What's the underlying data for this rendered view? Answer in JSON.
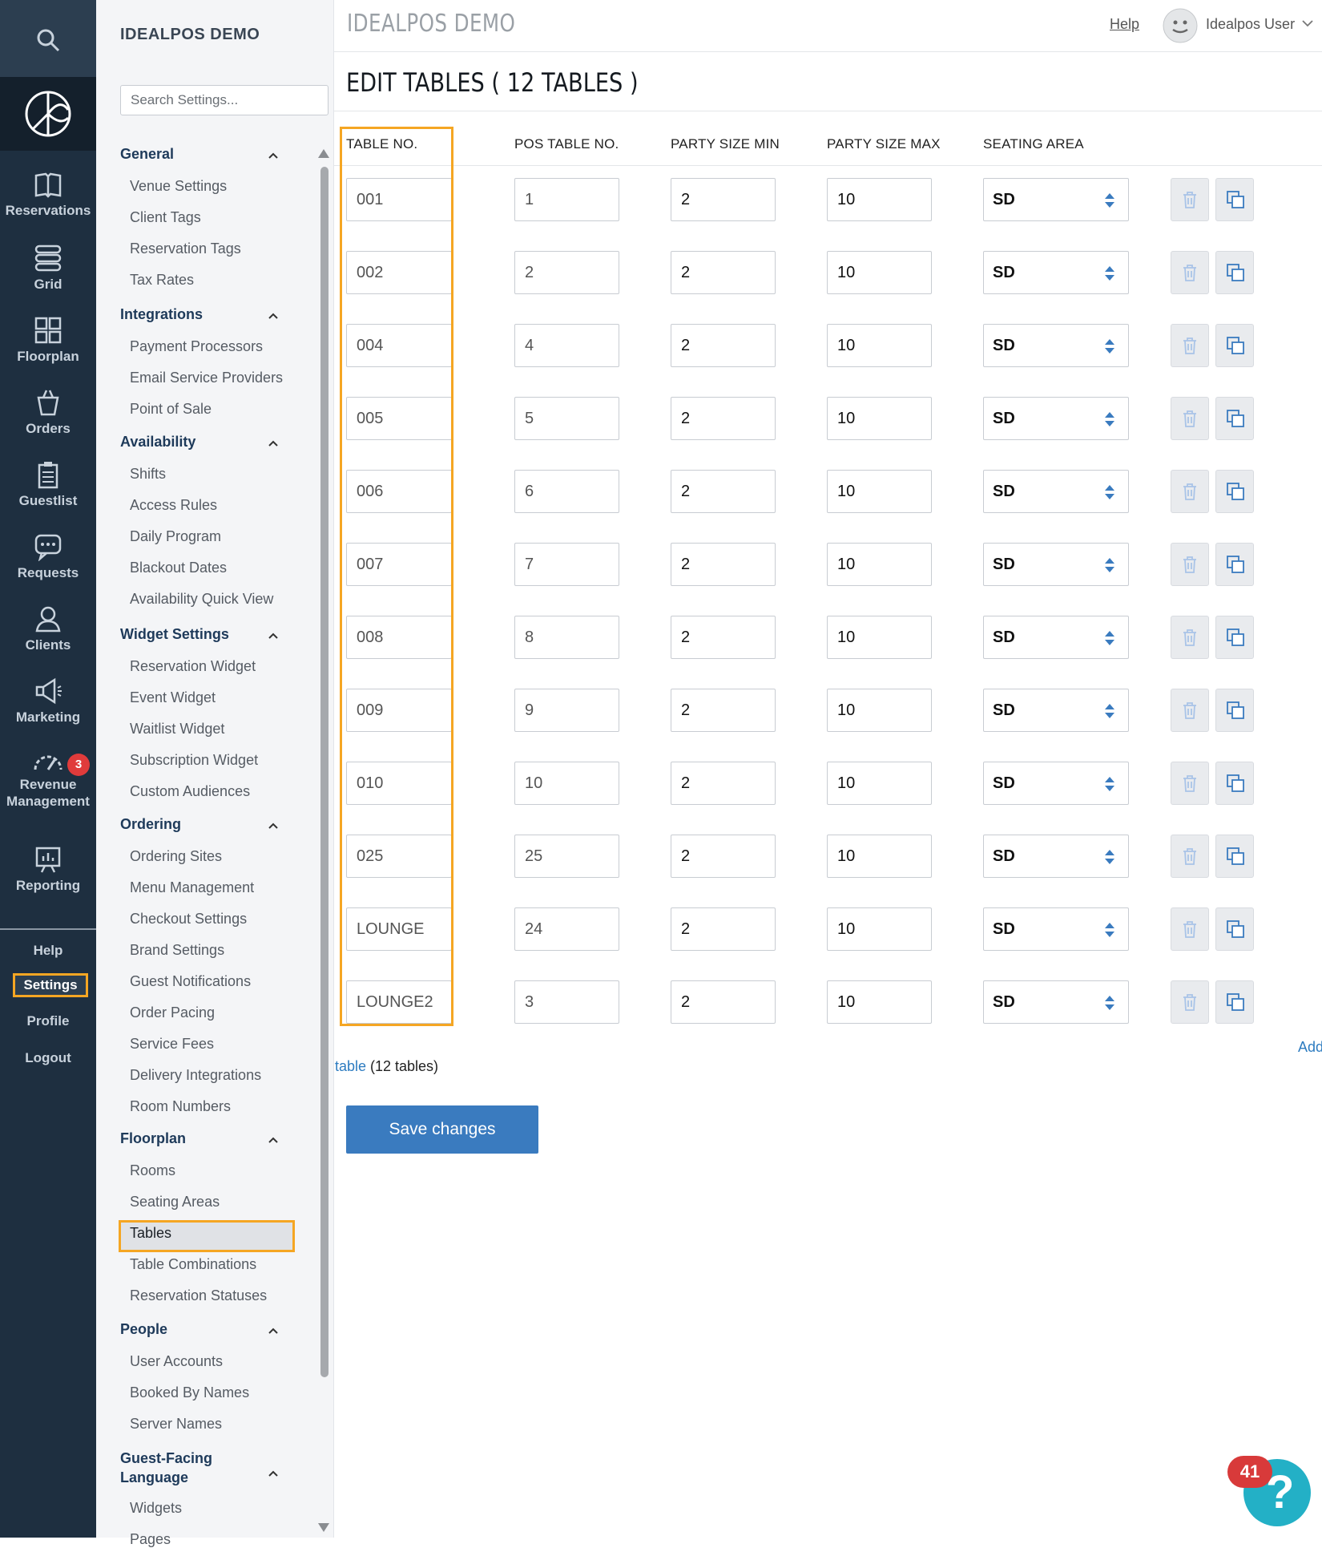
{
  "nav": {
    "items": [
      {
        "label": "Reservations",
        "icon": "book-icon"
      },
      {
        "label": "Grid",
        "icon": "grid-icon"
      },
      {
        "label": "Floorplan",
        "icon": "floorplan-icon"
      },
      {
        "label": "Orders",
        "icon": "orders-icon"
      },
      {
        "label": "Guestlist",
        "icon": "clipboard-icon"
      },
      {
        "label": "Requests",
        "icon": "chat-icon"
      },
      {
        "label": "Clients",
        "icon": "clients-icon"
      },
      {
        "label": "Marketing",
        "icon": "megaphone-icon"
      },
      {
        "label": "Revenue Management",
        "icon": "gauge-icon",
        "badge": "3"
      },
      {
        "label": "Reporting",
        "icon": "report-icon"
      }
    ],
    "links": {
      "help": "Help",
      "settings": "Settings",
      "profile": "Profile",
      "logout": "Logout"
    }
  },
  "sidebar": {
    "title": "IDEALPOS DEMO",
    "search_placeholder": "Search Settings...",
    "groups": [
      {
        "label": "General",
        "items": [
          "Venue Settings",
          "Client Tags",
          "Reservation Tags",
          "Tax Rates"
        ]
      },
      {
        "label": "Integrations",
        "items": [
          "Payment Processors",
          "Email Service Providers",
          "Point of Sale"
        ]
      },
      {
        "label": "Availability",
        "items": [
          "Shifts",
          "Access Rules",
          "Daily Program",
          "Blackout Dates",
          "Availability Quick View"
        ]
      },
      {
        "label": "Widget Settings",
        "items": [
          "Reservation Widget",
          "Event Widget",
          "Waitlist Widget",
          "Subscription Widget",
          "Custom Audiences"
        ]
      },
      {
        "label": "Ordering",
        "items": [
          "Ordering Sites",
          "Menu Management",
          "Checkout Settings",
          "Brand Settings",
          "Guest Notifications",
          "Order Pacing",
          "Service Fees",
          "Delivery Integrations",
          "Room Numbers"
        ]
      },
      {
        "label": "Floorplan",
        "items": [
          "Rooms",
          "Seating Areas",
          "Tables",
          "Table Combinations",
          "Reservation Statuses"
        ]
      },
      {
        "label": "People",
        "items": [
          "User Accounts",
          "Booked By Names",
          "Server Names"
        ]
      },
      {
        "label": "Guest-Facing Language",
        "items": [
          "Widgets",
          "Pages"
        ]
      }
    ],
    "active_item": "Tables"
  },
  "header": {
    "title": "IDEALPOS DEMO",
    "help": "Help",
    "user": "Idealpos User"
  },
  "main": {
    "heading": "EDIT TABLES ( 12 TABLES )",
    "columns": {
      "table_no": "TABLE NO.",
      "pos_table_no": "POS TABLE NO.",
      "party_min": "PARTY SIZE MIN",
      "party_max": "PARTY SIZE MAX",
      "seating_area": "SEATING AREA"
    },
    "rows": [
      {
        "table_no": "001",
        "pos": "1",
        "min": "2",
        "max": "10",
        "area": "SD"
      },
      {
        "table_no": "002",
        "pos": "2",
        "min": "2",
        "max": "10",
        "area": "SD"
      },
      {
        "table_no": "004",
        "pos": "4",
        "min": "2",
        "max": "10",
        "area": "SD"
      },
      {
        "table_no": "005",
        "pos": "5",
        "min": "2",
        "max": "10",
        "area": "SD"
      },
      {
        "table_no": "006",
        "pos": "6",
        "min": "2",
        "max": "10",
        "area": "SD"
      },
      {
        "table_no": "007",
        "pos": "7",
        "min": "2",
        "max": "10",
        "area": "SD"
      },
      {
        "table_no": "008",
        "pos": "8",
        "min": "2",
        "max": "10",
        "area": "SD"
      },
      {
        "table_no": "009",
        "pos": "9",
        "min": "2",
        "max": "10",
        "area": "SD"
      },
      {
        "table_no": "010",
        "pos": "10",
        "min": "2",
        "max": "10",
        "area": "SD"
      },
      {
        "table_no": "025",
        "pos": "25",
        "min": "2",
        "max": "10",
        "area": "SD"
      },
      {
        "table_no": "LOUNGE",
        "pos": "24",
        "min": "2",
        "max": "10",
        "area": "SD"
      },
      {
        "table_no": "LOUNGE2",
        "pos": "3",
        "min": "2",
        "max": "10",
        "area": "SD"
      }
    ],
    "add_link_a": "Add",
    "add_link_b": "table",
    "count": "(12 tables)",
    "save": "Save changes"
  },
  "help_widget": {
    "badge": "41",
    "glyph": "?"
  },
  "colors": {
    "nav_bg": "#1e2f40",
    "accent": "#3a7bbf",
    "highlight": "#f5a623",
    "badge": "#e03b3b",
    "help_bubble": "#23b0c6"
  }
}
